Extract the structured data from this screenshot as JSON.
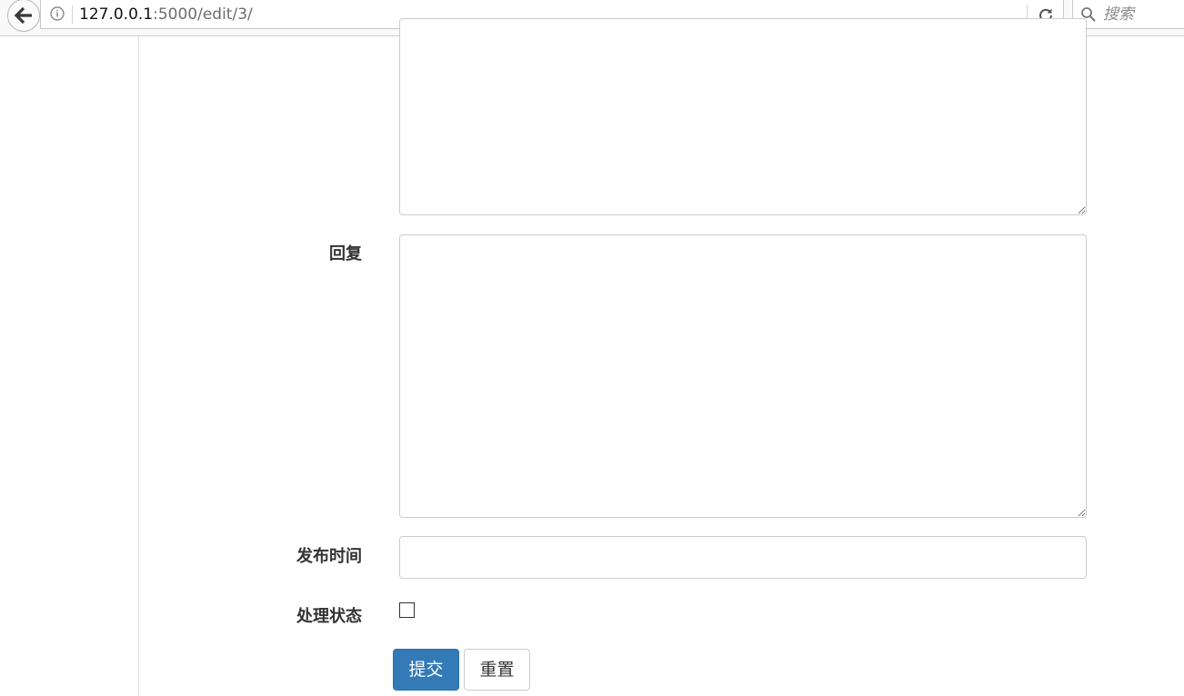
{
  "browser": {
    "url_host": "127.0.0.1",
    "url_rest": ":5000/edit/3/",
    "search_placeholder": "搜索"
  },
  "form": {
    "reply_label": "回复",
    "publish_time_label": "发布时间",
    "status_label": "处理状态",
    "status_checked": false,
    "submit_label": "提交",
    "reset_label": "重置",
    "accent_color": "#337ab7"
  },
  "icons": {
    "back": "arrow-left-icon",
    "info": "info-icon",
    "reload": "reload-icon",
    "search": "search-icon"
  }
}
